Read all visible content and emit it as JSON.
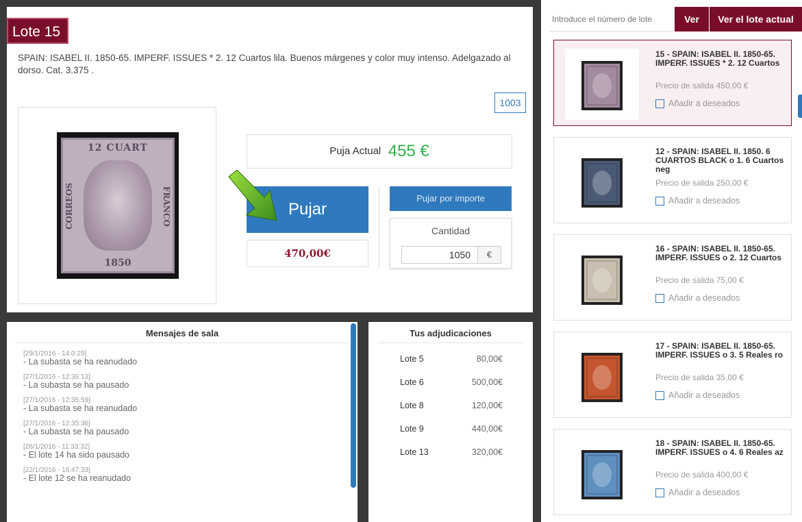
{
  "lot": {
    "badge": "Lote 15",
    "description": "SPAIN: ISABEL II. 1850-65. IMPERF. ISSUES * 2. 12 Cuartos lila. Buenos márgenes y color muy intenso. Adelgazado al dorso. Cat. 3.375 .",
    "counter": "1003",
    "stamp": {
      "top": "12 CUART",
      "bottom": "1850",
      "left": "CORREOS",
      "right": "FRANCO"
    }
  },
  "bidding": {
    "current_label": "Puja Actual",
    "current_value": "455 €",
    "pujar_label": "Pujar",
    "next_bid": "470,00€",
    "importe_button": "Pujar por importe",
    "cantidad_label": "Cantidad",
    "cantidad_value": "1050",
    "currency": "€"
  },
  "chat": {
    "title": "Mensajes de sala",
    "messages": [
      {
        "ts": "[29/1/2016 - 14:0:29]",
        "text": "- La subasta se ha reanudado"
      },
      {
        "ts": "[27/1/2016 - 12:36:13]",
        "text": "- La subasta se ha pausado"
      },
      {
        "ts": "[27/1/2016 - 12:35:59]",
        "text": "- La subasta se ha reanudado"
      },
      {
        "ts": "[27/1/2016 - 12:35:36]",
        "text": "- La subasta se ha pausado"
      },
      {
        "ts": "[26/1/2016 - 11:33:32]",
        "text": "- El lote 14 ha sido pausado"
      },
      {
        "ts": "[22/1/2016 - 16:47:33]",
        "text": "- El lote 12 se ha reanudado"
      }
    ]
  },
  "adjudicaciones": {
    "title": "Tus adjudicaciones",
    "rows": [
      {
        "lote": "Lote 5",
        "amount": "80,00€"
      },
      {
        "lote": "Lote 6",
        "amount": "500,00€"
      },
      {
        "lote": "Lote 8",
        "amount": "120,00€"
      },
      {
        "lote": "Lote 9",
        "amount": "440,00€"
      },
      {
        "lote": "Lote 13",
        "amount": "320,00€"
      }
    ]
  },
  "sidebar": {
    "search_placeholder": "Introduce el número de lote",
    "ver_label": "Ver",
    "ver_actual_label": "Ver el lote actual",
    "wish_label": "Añadir a deseados",
    "lots": [
      {
        "title": "15 - SPAIN: ISABEL II. 1850-65. IMPERF. ISSUES * 2. 12 Cuartos",
        "price": "Precio de salida 450,00 €",
        "active": true,
        "color": "#a28aa0"
      },
      {
        "title": "12 - SPAIN: ISABEL II. 1850. 6 CUARTOS BLACK o 1. 6 Cuartos neg",
        "price": "Precio de salida 250,00 €",
        "active": false,
        "color": "#4a5a74"
      },
      {
        "title": "16 - SPAIN: ISABEL II. 1850-65. IMPERF. ISSUES o 2. 12 Cuartos",
        "price": "Precio de salida 75,00 €",
        "active": false,
        "color": "#c9bfae"
      },
      {
        "title": "17 - SPAIN: ISABEL II. 1850-65. IMPERF. ISSUES o 3. 5 Reales ro",
        "price": "Precio de salida 35,00 €",
        "active": false,
        "color": "#c4552e"
      },
      {
        "title": "18 - SPAIN: ISABEL II. 1850-65. IMPERF. ISSUES o 4. 6 Reales az",
        "price": "Precio de salida 400,00 €",
        "active": false,
        "color": "#5f8fbf"
      }
    ]
  }
}
